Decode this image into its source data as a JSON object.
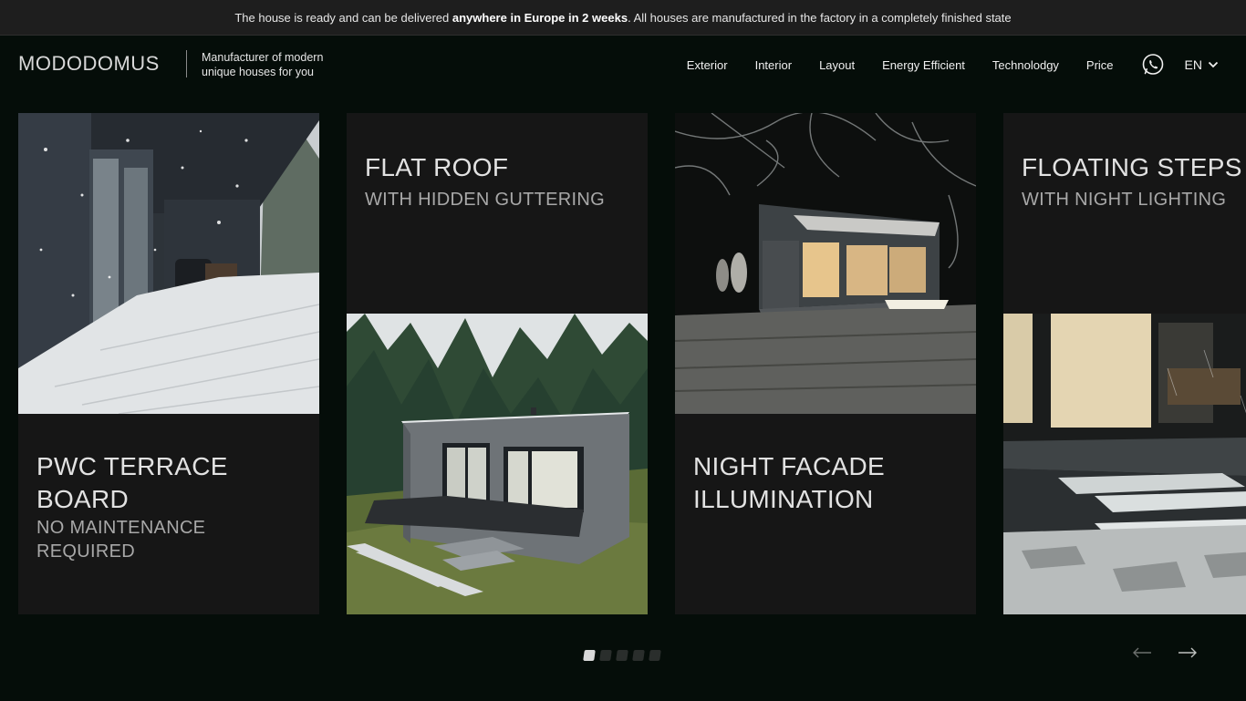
{
  "announcement": {
    "before": "The house is ready and can be delivered ",
    "bold": "anywhere in Europe in 2 weeks",
    "after": ". All houses are manufactured in the factory in a completely finished state"
  },
  "brand": {
    "logo_part1": "MODO",
    "logo_part2": "DOMUS",
    "tagline": "Manufacturer of modern unique houses for you"
  },
  "nav": {
    "items": [
      "Exterior",
      "Interior",
      "Layout",
      "Energy Efficient",
      "Technolodgy",
      "Price"
    ],
    "language": "EN"
  },
  "cards": [
    {
      "title": "PWC TERRACE BOARD",
      "subtitle": "NO MAINTENANCE REQUIRED"
    },
    {
      "title": "FLAT ROOF",
      "subtitle": "WITH HIDDEN GUTTERING"
    },
    {
      "title": "NIGHT FACADE ILLUMINATION",
      "subtitle": ""
    },
    {
      "title": "FLOATING STEPS",
      "subtitle": "WITH NIGHT LIGHTING"
    }
  ],
  "pagination": {
    "total": 5,
    "active_index": 0
  },
  "icons": {
    "whatsapp": "whatsapp-icon",
    "chevron": "chevron-down-icon",
    "prev": "arrow-left-icon",
    "next": "arrow-right-icon"
  },
  "colors": {
    "background": "#050d09",
    "card": "#161616",
    "topbar": "#1e1e1e"
  }
}
